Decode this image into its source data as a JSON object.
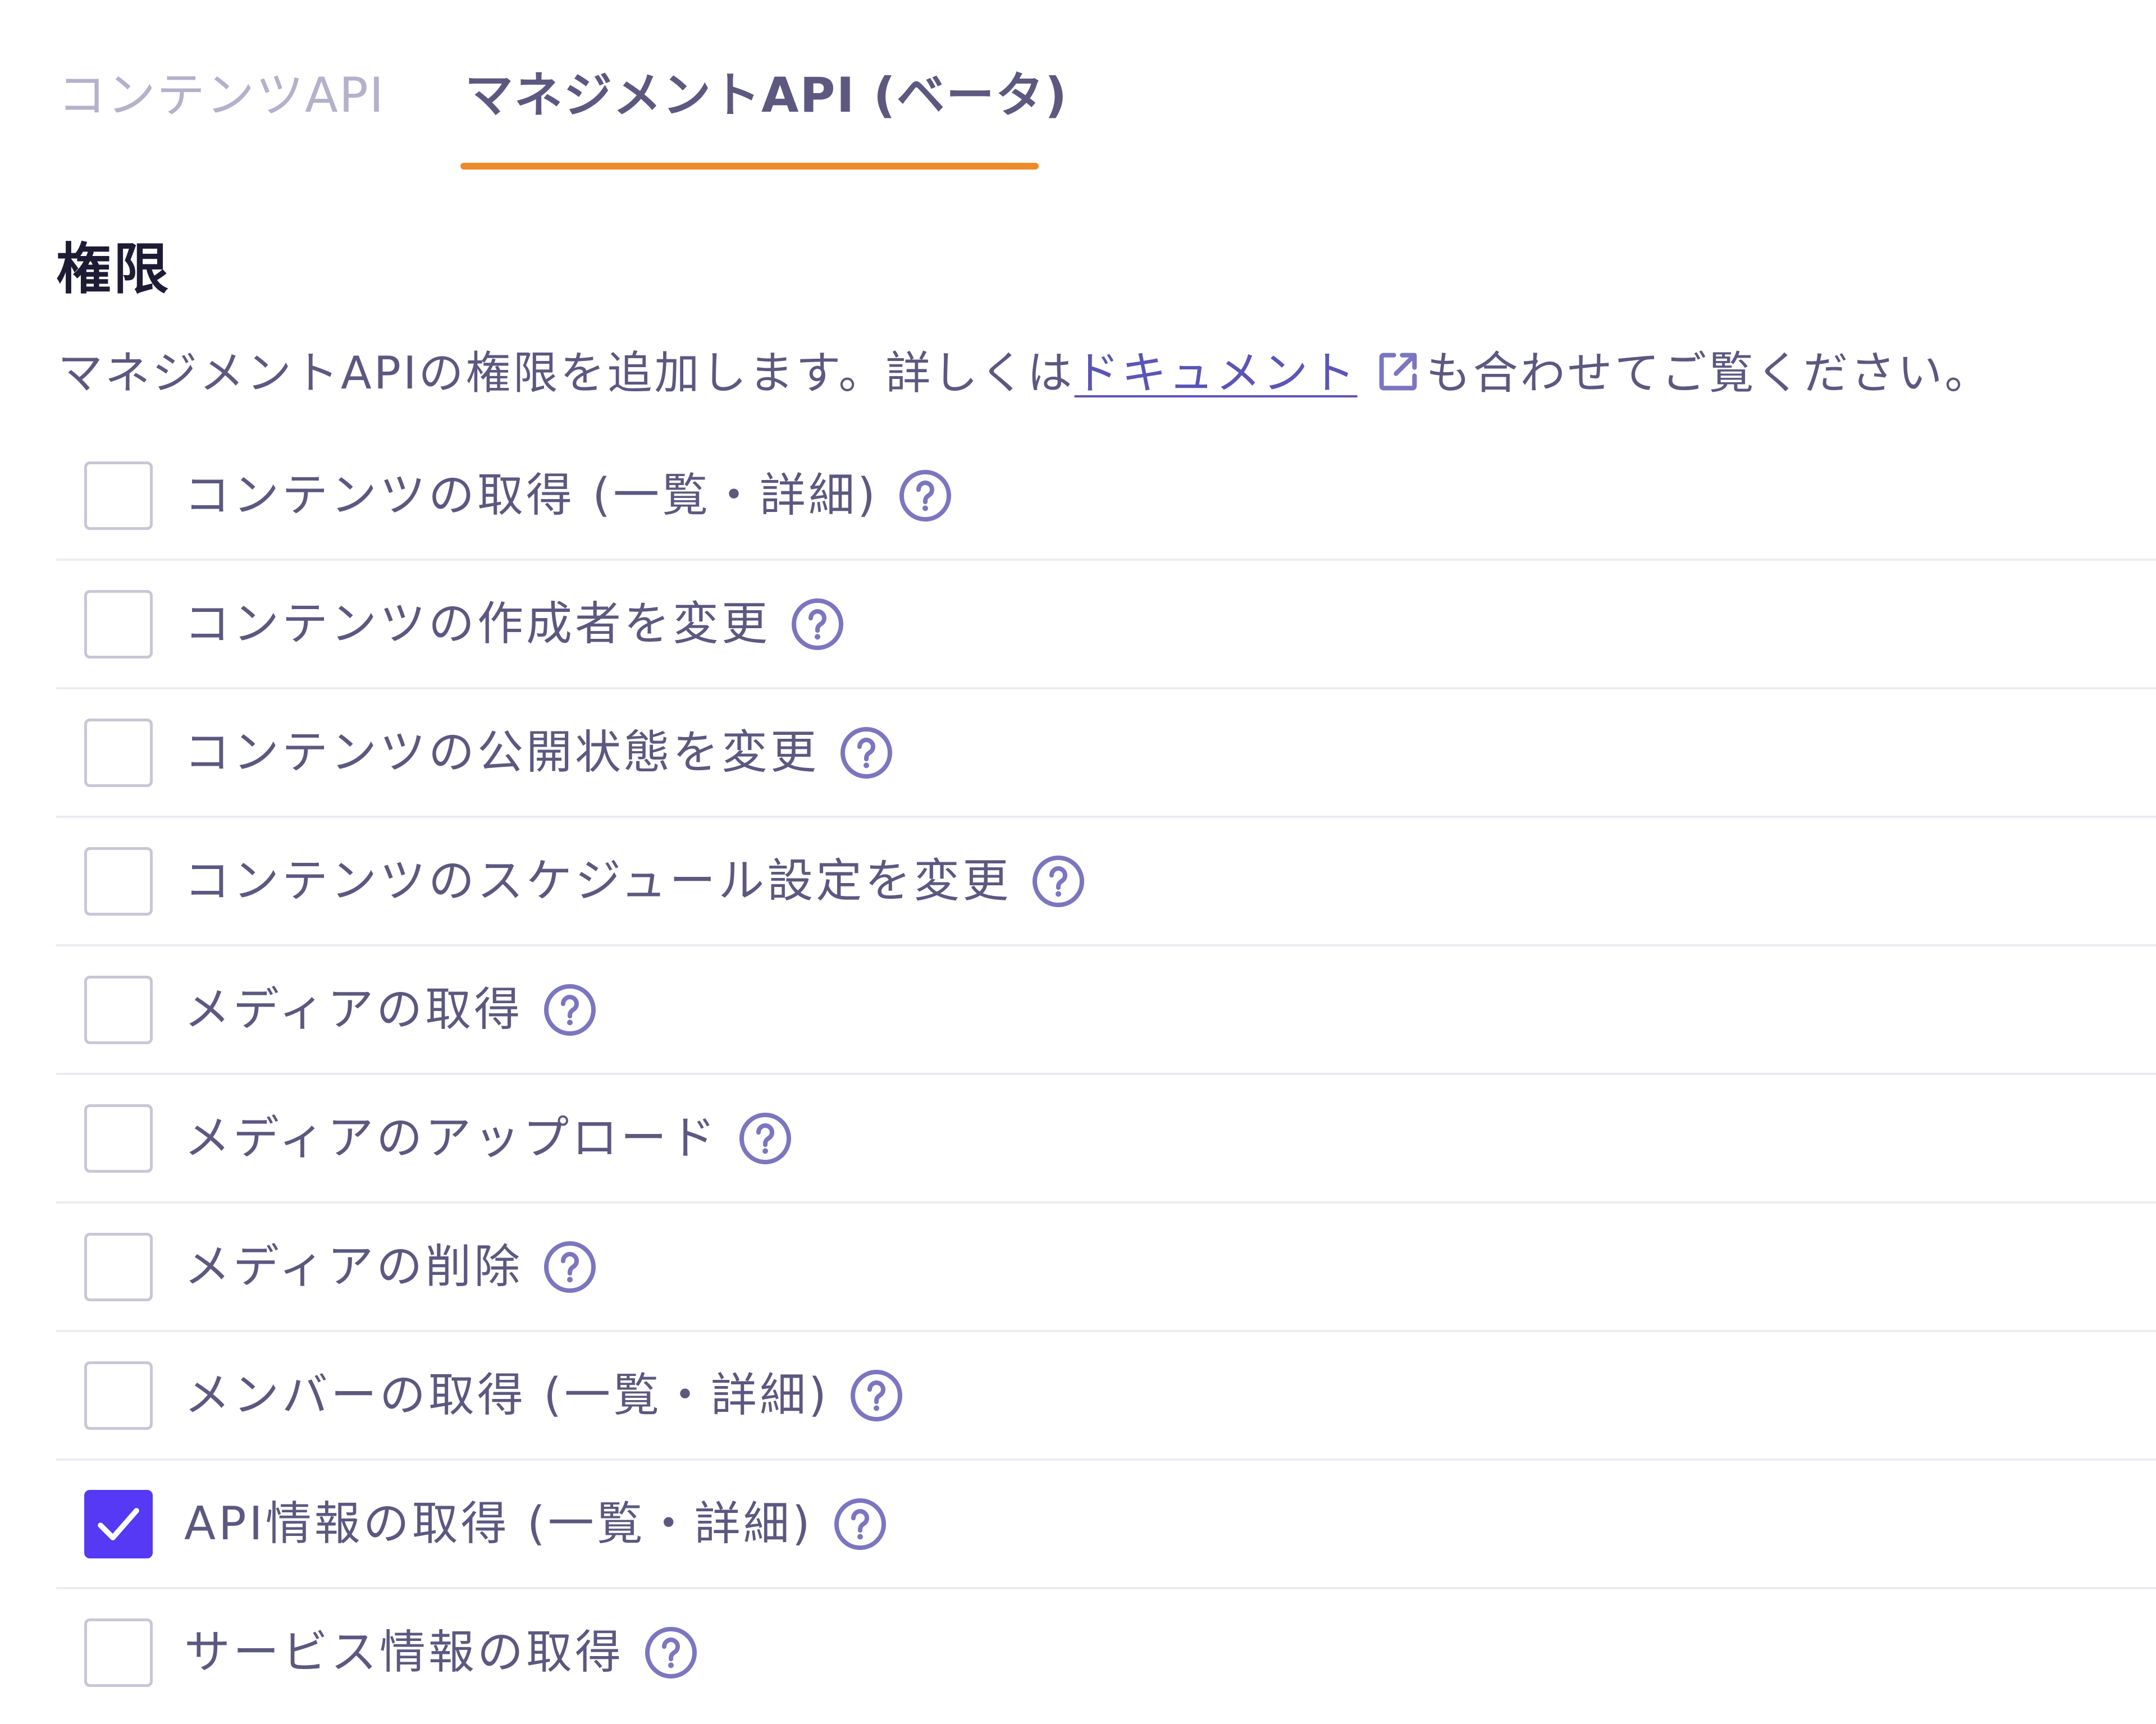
{
  "tabs": [
    {
      "label": "コンテンツAPI",
      "active": false
    },
    {
      "label": "マネジメントAPI (ベータ)",
      "active": true
    }
  ],
  "colors": {
    "accent_underline": "#f0892a",
    "checkbox_checked": "#5639f5",
    "link": "#5b55b6",
    "icon": "#7b76bf"
  },
  "section": {
    "title": "権限",
    "description_before": "マネジメントAPIの権限を追加します。詳しくは",
    "description_link": "ドキュメント",
    "description_after": "も合わせてご覧ください。",
    "link_icon": "external-link-icon"
  },
  "permissions": [
    {
      "label": "コンテンツの取得 (一覧・詳細)",
      "checked": false,
      "icon": "help-circle-icon"
    },
    {
      "label": "コンテンツの作成者を変更",
      "checked": false,
      "icon": "help-circle-icon"
    },
    {
      "label": "コンテンツの公開状態を変更",
      "checked": false,
      "icon": "help-circle-icon"
    },
    {
      "label": "コンテンツのスケジュール設定を変更",
      "checked": false,
      "icon": "help-circle-icon"
    },
    {
      "label": "メディアの取得",
      "checked": false,
      "icon": "help-circle-icon"
    },
    {
      "label": "メディアのアップロード",
      "checked": false,
      "icon": "help-circle-icon"
    },
    {
      "label": "メディアの削除",
      "checked": false,
      "icon": "help-circle-icon"
    },
    {
      "label": "メンバーの取得 (一覧・詳細)",
      "checked": false,
      "icon": "help-circle-icon"
    },
    {
      "label": "API情報の取得 (一覧・詳細)",
      "checked": true,
      "icon": "help-circle-icon"
    },
    {
      "label": "サービス情報の取得",
      "checked": false,
      "icon": "help-circle-icon"
    }
  ]
}
